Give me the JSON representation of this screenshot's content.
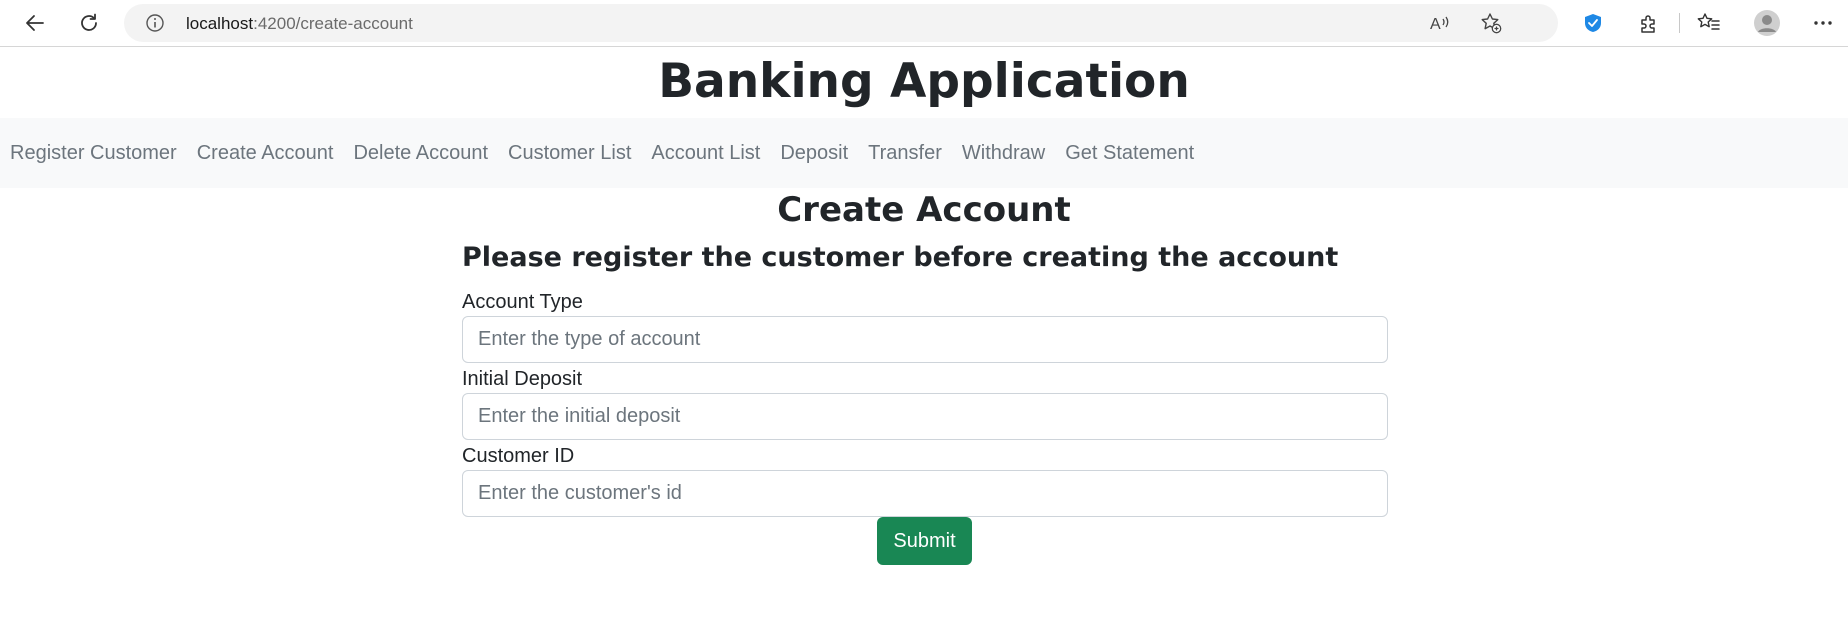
{
  "browser": {
    "url_host": "localhost",
    "url_path": ":4200/create-account",
    "icons": [
      "back-arrow-icon",
      "refresh-icon",
      "info-icon",
      "read-aloud-icon",
      "add-favorite-icon",
      "extension-shield-icon",
      "puzzle-icon",
      "favorites-icon",
      "profile-icon",
      "more-icon"
    ]
  },
  "app": {
    "title": "Banking Application"
  },
  "nav": {
    "items": [
      {
        "label": "Register Customer"
      },
      {
        "label": "Create Account"
      },
      {
        "label": "Delete Account"
      },
      {
        "label": "Customer List"
      },
      {
        "label": "Account List"
      },
      {
        "label": "Deposit"
      },
      {
        "label": "Transfer"
      },
      {
        "label": "Withdraw"
      },
      {
        "label": "Get Statement"
      }
    ]
  },
  "form": {
    "title": "Create Account",
    "subtitle": "Please register the customer before creating the account",
    "fields": [
      {
        "label": "Account Type",
        "placeholder": "Enter the type of account",
        "value": ""
      },
      {
        "label": "Initial Deposit",
        "placeholder": "Enter the initial deposit",
        "value": ""
      },
      {
        "label": "Customer ID",
        "placeholder": "Enter the customer's id",
        "value": ""
      }
    ],
    "submit_label": "Submit"
  },
  "colors": {
    "submit_bg": "#198754",
    "navbar_bg": "#f8f9fa",
    "nav_link": "#6c757d",
    "extension_accent": "#1e88e5"
  }
}
